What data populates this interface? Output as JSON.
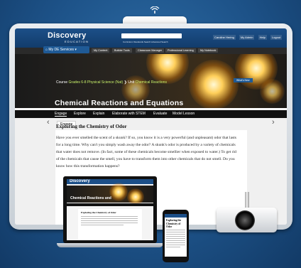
{
  "header": {
    "logo": "Discovery",
    "logo_sub": "EDUCATION",
    "my_services": "My DE Services",
    "search_links": "Curriculum Standards Search   Advanced Search",
    "nav": [
      "Caroline Hering",
      "My Admin",
      "Help",
      "Logout"
    ]
  },
  "menu": {
    "items": [
      "My Content",
      "Builder Tools",
      "Classroom Manager",
      "Professional Learning",
      "My Notebook"
    ]
  },
  "banner": {
    "breadcrumb_course_label": "Course",
    "breadcrumb_course": "Grades 6-8 Physical Science (Nat)",
    "breadcrumb_unit_label": "Unit",
    "breadcrumb_unit": "Chemical Reactions",
    "whats_new": "What's New",
    "title": "Chemical Reactions and Equations"
  },
  "tabs": [
    "Engage",
    "Explore",
    "Explain",
    "Elaborate with STEM",
    "Evaluate",
    "Model Lesson"
  ],
  "content": {
    "section_button": "Engage",
    "article_title": "Exploring the Chemistry of Odor",
    "article_text": "Have you ever smelled the scent of a skunk? If so, you know it is a very powerful (and unpleasant) odor that lasts for a long time. Why can't you simply wash away the odor? A skunk's odor is produced by a variety of chemicals that water does not remove. (In fact, some of these chemicals become smellier when exposed to water.) To get rid of the chemicals that cause the smell, you have to transform them into other chemicals that do not smell. Do you know how this transformation happens?",
    "article_tail": "about the nature of reactive... may interact with other..."
  },
  "laptop": {
    "logo": "Discovery",
    "title": "Chemical Reactions and",
    "article_title": "Exploring the Chemistry of Odor"
  },
  "phone": {
    "article_title": "Exploring the Chemistry of Odor"
  },
  "colors": {
    "brand_blue": "#1c4f88",
    "accent_green": "#c8f06a",
    "dark_bar": "#111111"
  }
}
